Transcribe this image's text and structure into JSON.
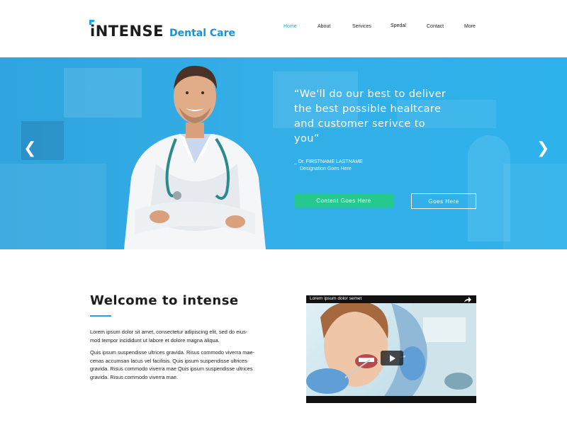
{
  "brand": {
    "name": "iNTENSE",
    "subtitle": "Dental Care",
    "accent": "#1fa3e6"
  },
  "nav": {
    "items": [
      {
        "label": "Home",
        "active": true
      },
      {
        "label": "About",
        "active": false
      },
      {
        "label": "Services",
        "active": false
      },
      {
        "label": "Spedal",
        "active": false
      },
      {
        "label": "Contact",
        "active": false
      },
      {
        "label": "More",
        "active": false
      }
    ]
  },
  "hero": {
    "quote_lines": [
      "“We'll do our best to deliver",
      "the best possible healtcare",
      "and customer serivce to",
      "you”"
    ],
    "attribution_name": "_ Dr. FIRSTNAME LASTNAME",
    "attribution_designation": "Designation Goes Here",
    "primary_button": "Content Goes Here",
    "secondary_button": "Goes Here",
    "prev_arrow": "❮",
    "next_arrow": "❯",
    "background_color": "#34aee6",
    "primary_button_color": "#25c98e"
  },
  "welcome": {
    "title": "Welcome to intense",
    "paragraph1_lines": [
      "Lorem ipsum dolor sit amet, consectetur adipiscing elit, sed do eius-",
      "mod tempor incididunt ut labore et dolore magna aliqua."
    ],
    "paragraph2_lines": [
      "Quis ipsum suspendisse ultrices gravida. Risus commodo viverra mae-",
      "cenas accumsan lacus vel facilisis. Quis ipsum suspendisse ultrices",
      "gravida. Risus commodo viverra mae Quis ipsum suspendisse ultrices",
      "gravida. Risus commodo viverra mae."
    ]
  },
  "video": {
    "title": "Lorem ipsum dolor semet",
    "share_icon": "share-icon",
    "play_icon": "play-icon"
  }
}
